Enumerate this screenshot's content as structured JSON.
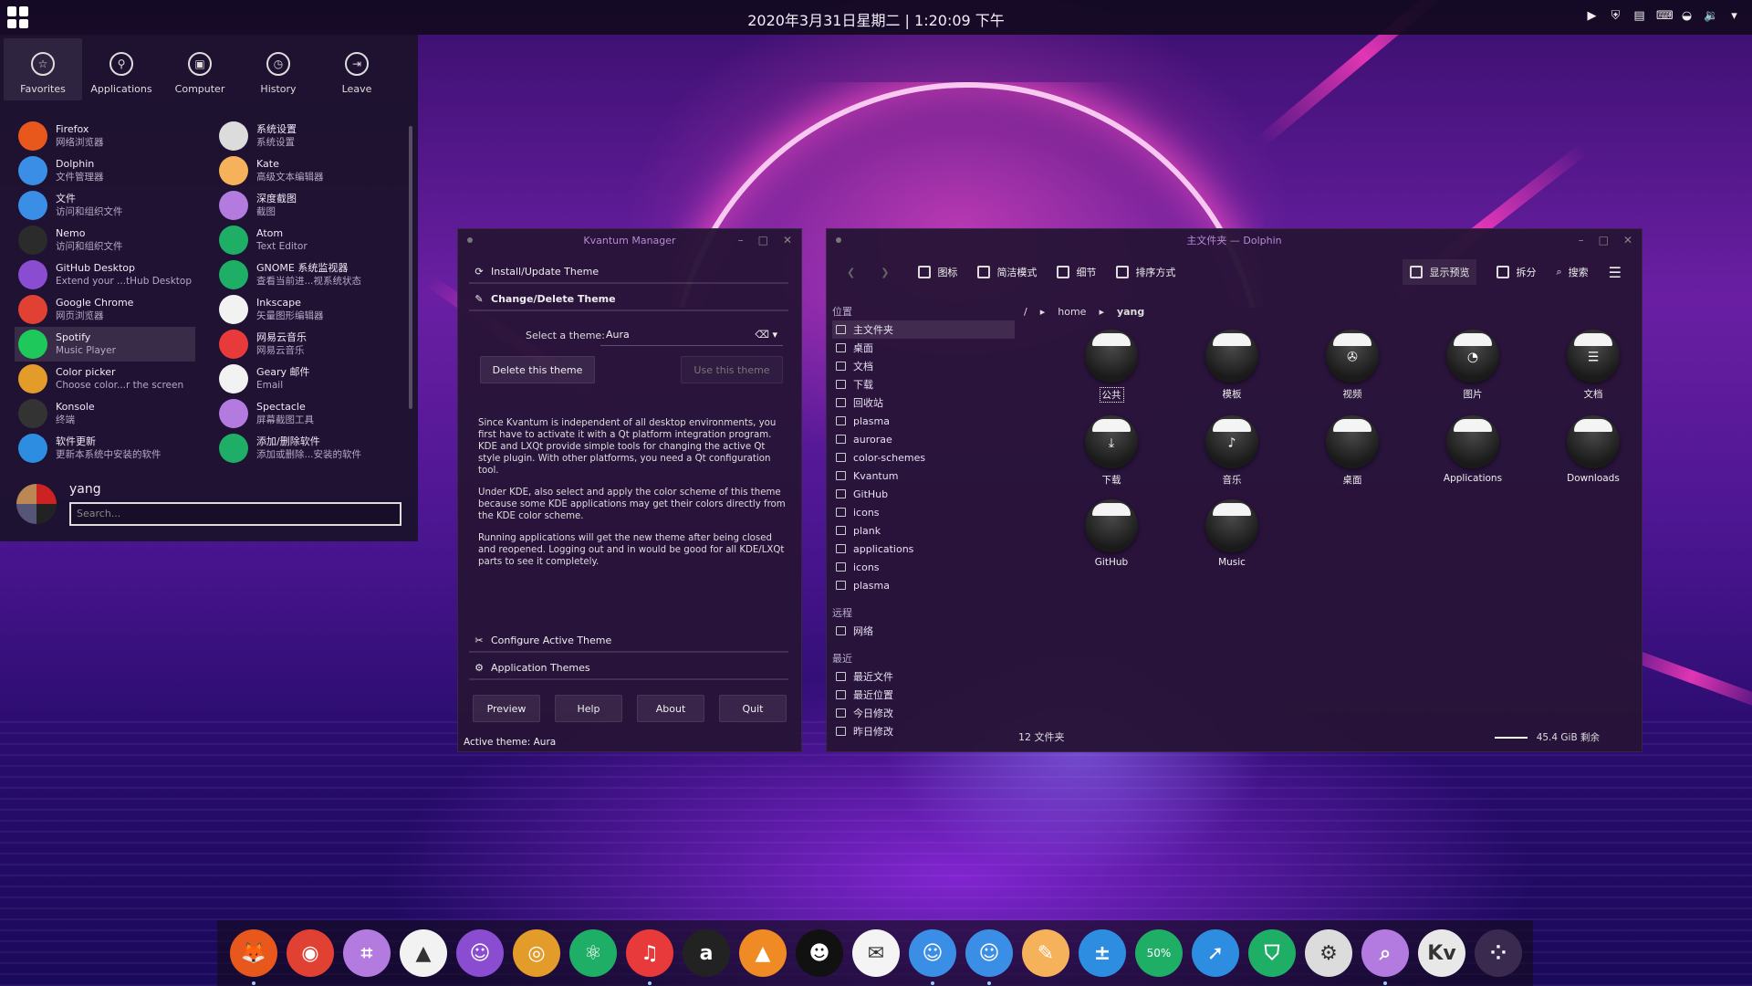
{
  "topbar": {
    "clock": "2020年3月31日星期二 | 1:20:09 下午"
  },
  "launcher": {
    "tabs": [
      "Favorites",
      "Applications",
      "Computer",
      "History",
      "Leave"
    ],
    "left_apps": [
      {
        "name": "Firefox",
        "desc": "网络浏览器",
        "color": "#e8581c"
      },
      {
        "name": "Dolphin",
        "desc": "文件管理器",
        "color": "#3b8ee6"
      },
      {
        "name": "文件",
        "desc": "访问和组织文件",
        "color": "#3b8ee6"
      },
      {
        "name": "Nemo",
        "desc": "访问和组织文件",
        "color": "#2b2b2b"
      },
      {
        "name": "GitHub Desktop",
        "desc": "Extend your ...tHub Desktop",
        "color": "#8a4cd1"
      },
      {
        "name": "Google Chrome",
        "desc": "网页浏览器",
        "color": "#e04133"
      },
      {
        "name": "Spotify",
        "desc": "Music Player",
        "color": "#1ec85a"
      },
      {
        "name": "Color picker",
        "desc": "Choose color...r the screen",
        "color": "#e39b2a"
      },
      {
        "name": "Konsole",
        "desc": "终端",
        "color": "#333"
      },
      {
        "name": "软件更新",
        "desc": "更新本系统中安装的软件",
        "color": "#2d8de0"
      }
    ],
    "right_apps": [
      {
        "name": "系统设置",
        "desc": "系统设置",
        "color": "#dcdcdc"
      },
      {
        "name": "Kate",
        "desc": "高级文本编辑器",
        "color": "#f5b25a"
      },
      {
        "name": "深度截图",
        "desc": "截图",
        "color": "#b37be0"
      },
      {
        "name": "Atom",
        "desc": "Text Editor",
        "color": "#1fae66"
      },
      {
        "name": "GNOME 系统监视器",
        "desc": "查看当前进...视系统状态",
        "color": "#1fae66"
      },
      {
        "name": "Inkscape",
        "desc": "矢量图形编辑器",
        "color": "#f2f2f2"
      },
      {
        "name": "网易云音乐",
        "desc": "网易云音乐",
        "color": "#e83a3a"
      },
      {
        "name": "Geary 邮件",
        "desc": "Email",
        "color": "#f2f2f2"
      },
      {
        "name": "Spectacle",
        "desc": "屏幕截图工具",
        "color": "#b37be0"
      },
      {
        "name": "添加/删除软件",
        "desc": "添加或删除...安装的软件",
        "color": "#1fae66"
      }
    ],
    "user": "yang",
    "search_placeholder": "Search..."
  },
  "kvantum": {
    "title": "Kvantum Manager",
    "sections": [
      "Install/Update Theme",
      "Change/Delete Theme",
      "Configure Active Theme",
      "Application Themes"
    ],
    "select_label": "Select a theme:",
    "selected_theme": "Aura",
    "delete_btn": "Delete this theme",
    "use_btn": "Use this theme",
    "paragraphs": [
      "Since Kvantum is independent of all desktop environments, you first have to activate it with a Qt platform integration program. KDE and LXQt provide simple tools for changing the active Qt style plugin. With other platforms, you need a Qt configuration tool.",
      "Under KDE, also select and apply the color scheme of this theme because some KDE applications may get their colors directly from the KDE color scheme.",
      "Running applications will get the new theme after being closed and reopened. Logging out and in would be good for all KDE/LXQt parts to see it completely."
    ],
    "buttons": [
      "Preview",
      "Help",
      "About",
      "Quit"
    ],
    "active_theme": "Active theme: Aura"
  },
  "dolphin": {
    "title": "主文件夹 — Dolphin",
    "toolbar": [
      "图标",
      "简洁模式",
      "细节",
      "排序方式",
      "显示预览",
      "拆分",
      "搜索"
    ],
    "places_head": "位置",
    "places": [
      "主文件夹",
      "桌面",
      "文档",
      "下载",
      "回收站",
      "plasma",
      "aurorae",
      "color-schemes",
      "Kvantum",
      "GitHub",
      "icons",
      "plank",
      "applications",
      "icons",
      "plasma"
    ],
    "remote_head": "远程",
    "remote": [
      "网络"
    ],
    "recent_head": "最近",
    "recent": [
      "最近文件",
      "最近位置",
      "今日修改",
      "昨日修改"
    ],
    "crumb": [
      "/",
      "home",
      "yang"
    ],
    "files": [
      {
        "name": "公共",
        "glyph": ""
      },
      {
        "name": "模板",
        "glyph": ""
      },
      {
        "name": "视频",
        "glyph": "✇"
      },
      {
        "name": "图片",
        "glyph": "◔"
      },
      {
        "name": "文档",
        "glyph": "☰"
      },
      {
        "name": "下载",
        "glyph": "⤓"
      },
      {
        "name": "音乐",
        "glyph": "♪"
      },
      {
        "name": "桌面",
        "glyph": ""
      },
      {
        "name": "Applications",
        "glyph": ""
      },
      {
        "name": "Downloads",
        "glyph": ""
      },
      {
        "name": "GitHub",
        "glyph": ""
      },
      {
        "name": "Music",
        "glyph": ""
      }
    ],
    "status": "12 文件夹",
    "free": "45.4 GiB 剩余"
  },
  "dock": [
    {
      "name": "firefox-icon",
      "color": "#e8581c",
      "glyph": "🦊",
      "dot": true
    },
    {
      "name": "chrome-icon",
      "color": "#e04133",
      "glyph": "◉",
      "dot": false
    },
    {
      "name": "screenshot-icon",
      "color": "#b37be0",
      "glyph": "⌗",
      "dot": false
    },
    {
      "name": "inkscape-icon",
      "color": "#f2f2f2",
      "glyph": "▲",
      "dot": false
    },
    {
      "name": "github-icon",
      "color": "#8a4cd1",
      "glyph": "☺",
      "dot": false
    },
    {
      "name": "colorpicker-icon",
      "color": "#e39b2a",
      "glyph": "◎",
      "dot": false
    },
    {
      "name": "atom-icon",
      "color": "#1fae66",
      "glyph": "⚛",
      "dot": false
    },
    {
      "name": "netease-icon",
      "color": "#e83a3a",
      "glyph": "♫",
      "dot": true
    },
    {
      "name": "anki-icon",
      "color": "#222",
      "glyph": "a",
      "dot": false
    },
    {
      "name": "vlc-icon",
      "color": "#f08a24",
      "glyph": "▲",
      "dot": false
    },
    {
      "name": "qq-icon",
      "color": "#111",
      "glyph": "☻",
      "dot": false
    },
    {
      "name": "geary-icon",
      "color": "#f4f4f4",
      "glyph": "✉",
      "dot": false
    },
    {
      "name": "finder-icon",
      "color": "#3b8ee6",
      "glyph": "☺",
      "dot": true
    },
    {
      "name": "dolphin-icon",
      "color": "#3b8ee6",
      "glyph": "☺",
      "dot": true
    },
    {
      "name": "kate-icon",
      "color": "#f5b25a",
      "glyph": "✎",
      "dot": false
    },
    {
      "name": "calculator-icon",
      "color": "#2d8de0",
      "glyph": "±",
      "dot": false
    },
    {
      "name": "sysmon-icon",
      "color": "#1fae66",
      "glyph": "50%",
      "dot": false
    },
    {
      "name": "update-icon",
      "color": "#2d8de0",
      "glyph": "➚",
      "dot": false
    },
    {
      "name": "software-icon",
      "color": "#1fae66",
      "glyph": "⛉",
      "dot": false
    },
    {
      "name": "settings-icon",
      "color": "#dcdcdc",
      "glyph": "⚙",
      "dot": false
    },
    {
      "name": "spectacle-icon",
      "color": "#b37be0",
      "glyph": "⌕",
      "dot": true
    },
    {
      "name": "kvantum-icon",
      "color": "#e8e8e8",
      "glyph": "Kv",
      "dot": false
    },
    {
      "name": "more-icon",
      "color": "#3a2a50",
      "glyph": "⁘",
      "dot": false
    }
  ]
}
